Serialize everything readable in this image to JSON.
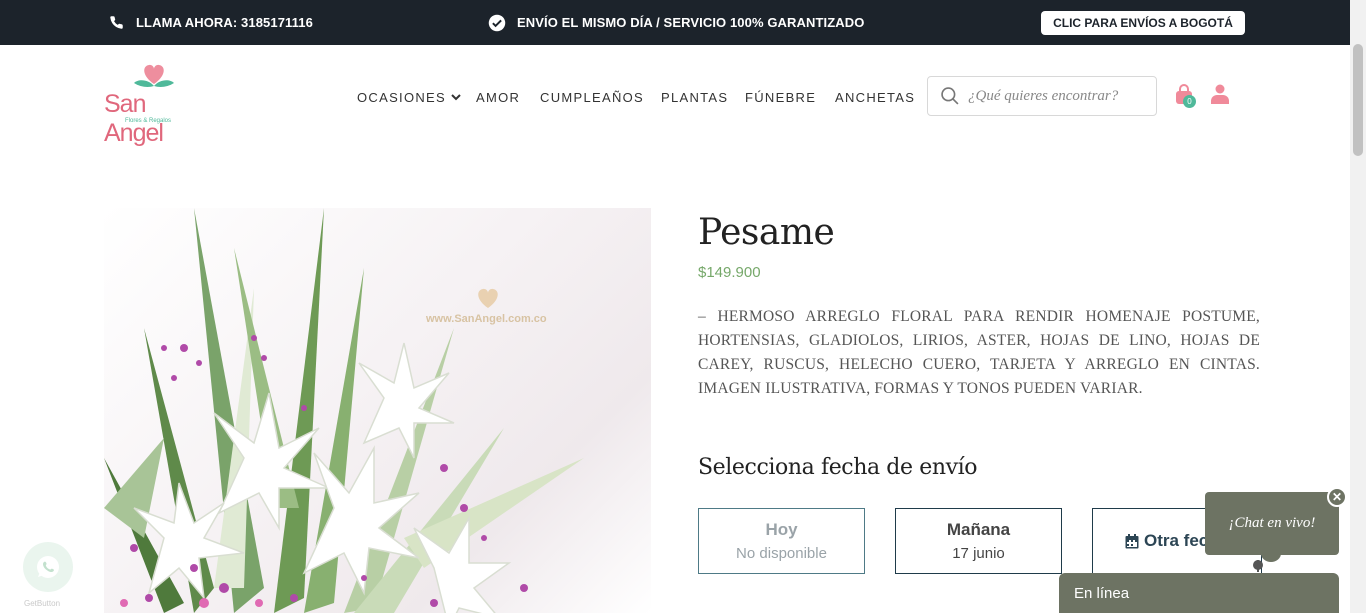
{
  "topbar": {
    "phone_text": "LLAMA AHORA: 3185171116",
    "shipping_text": "ENVÍO EL MISMO DÍA / SERVICIO 100% GARANTIZADO",
    "bogota_button": "CLIC PARA ENVÍOS A BOGOTÁ"
  },
  "logo": {
    "name": "San Angel",
    "tagline": "Flores & Regalos"
  },
  "nav": [
    {
      "label": "OCASIONES"
    },
    {
      "label": "AMOR"
    },
    {
      "label": "CUMPLEAÑOS"
    },
    {
      "label": "PLANTAS"
    },
    {
      "label": "FÚNEBRE"
    },
    {
      "label": "ANCHETAS"
    }
  ],
  "search": {
    "placeholder": "¿Qué quieres encontrar?"
  },
  "cart": {
    "count": "0"
  },
  "product": {
    "image_watermark": "www.SanAngel.com.co",
    "title": "Pesame",
    "price": "$149.900",
    "description": "– HERMOSO ARREGLO FLORAL PARA RENDIR HOMENAJE POSTUME, HORTENSIAS, GLADIOLOS, LIRIOS, ASTER, HOJAS DE LINO, HOJAS DE CAREY, RUSCUS, HELECHO CUERO, TARJETA Y ARREGLO EN CINTAS. IMAGEN ILUSTRATIVA, FORMAS Y TONOS PUEDEN VARIAR."
  },
  "delivery": {
    "title": "Selecciona fecha de envío",
    "options": [
      {
        "label": "Hoy",
        "sub": "No disponible"
      },
      {
        "label": "Mañana",
        "sub": "17 junio"
      },
      {
        "label": "Otra fec"
      }
    ]
  },
  "chat": {
    "bubble": "¡Chat en vivo!",
    "status": "En línea"
  },
  "whatsapp": {
    "label": "GetButton"
  },
  "colors": {
    "topbar": "#1c232b",
    "brand_pink": "#e0677c",
    "brand_green": "#4fb99a",
    "price": "#76a86a",
    "chat": "#6d7363"
  }
}
